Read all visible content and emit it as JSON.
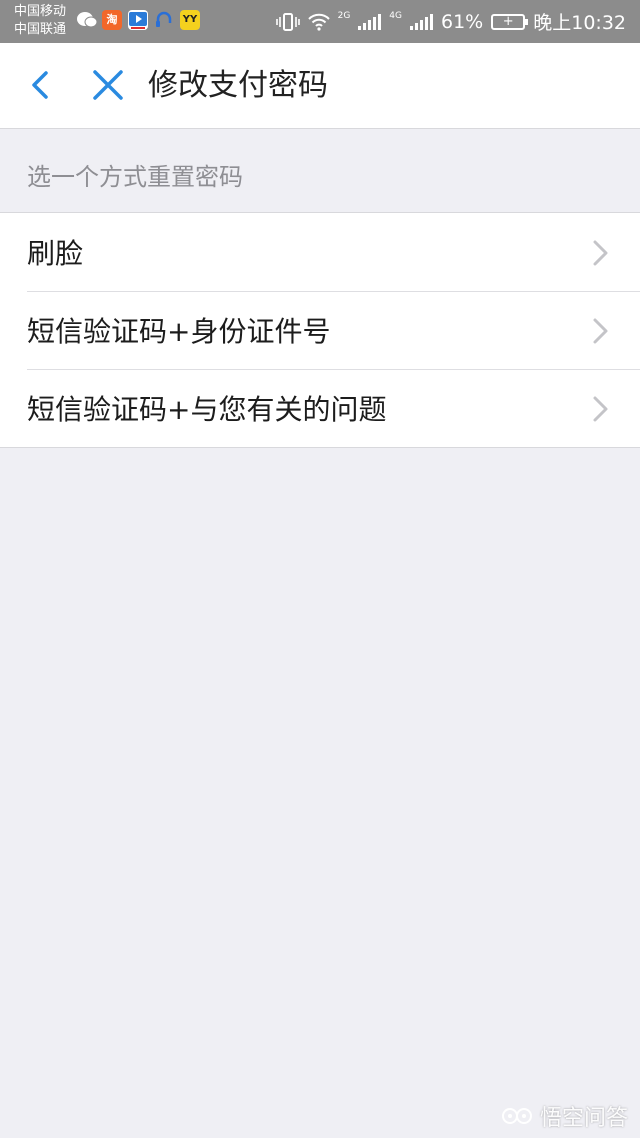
{
  "status_bar": {
    "carrier_1": "中国移动",
    "carrier_2": "中国联通",
    "app_icons": [
      {
        "name": "wechat-icon",
        "color": "#9a9a9a",
        "glyph": ""
      },
      {
        "name": "taobao-icon",
        "color": "#f2672a",
        "glyph": "淘"
      },
      {
        "name": "video-app-icon",
        "color": "#2b7bd8",
        "glyph": "▶"
      },
      {
        "name": "headset-app-icon",
        "color": "#2a6fd6",
        "glyph": ""
      },
      {
        "name": "yy-app-icon",
        "color": "#f4d11e",
        "glyph": "YY"
      }
    ],
    "network_1": "2G",
    "network_2": "4G",
    "battery": "61%",
    "time": "晚上10:32"
  },
  "nav": {
    "title": "修改支付密码",
    "accent_color": "#2a8ae0"
  },
  "section": {
    "header": "选一个方式重置密码"
  },
  "options": [
    {
      "label": "刷脸"
    },
    {
      "label": "短信验证码+身份证件号"
    },
    {
      "label": "短信验证码+与您有关的问题"
    }
  ],
  "watermark": {
    "text": "悟空问答"
  }
}
